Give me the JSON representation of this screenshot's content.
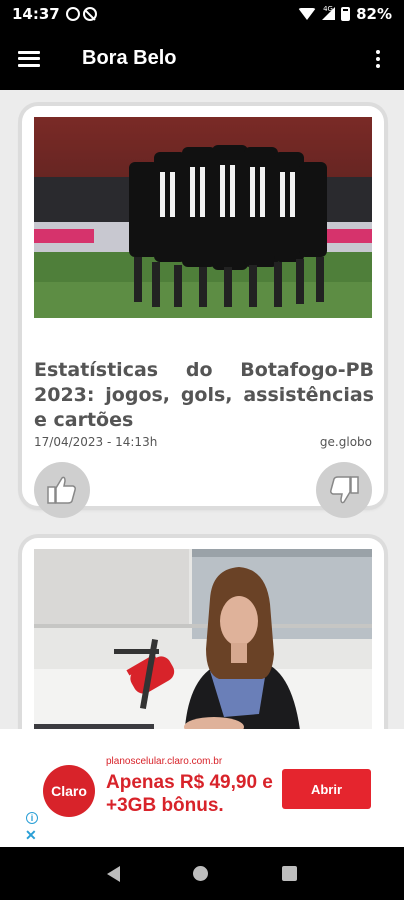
{
  "status_bar": {
    "time": "14:37",
    "battery": "82%",
    "network_tag": "4G",
    "icons": [
      "whatsapp-icon",
      "blocked-icon",
      "wifi-icon",
      "signal-icon",
      "battery-icon"
    ]
  },
  "app_bar": {
    "title": "Bora Belo",
    "icons": [
      "hamburger-menu-icon",
      "more-vert-icon"
    ]
  },
  "feed": {
    "articles": [
      {
        "title": "Estatísticas do Botafogo-PB 2023: jogos, gols, assistências e cartões",
        "date": "17/04/2023 - 14:13h",
        "source": "ge.globo",
        "image": "team-huddle-photo",
        "actions": [
          "thumbs-up-icon",
          "thumbs-down-icon"
        ]
      },
      {
        "title": "",
        "image": "woman-radio-studio-photo"
      }
    ]
  },
  "ad": {
    "logo_text": "Claro",
    "url": "planoscelular.claro.com.br",
    "headline": "Apenas R$ 49,90 e +3GB bônus.",
    "cta": "Abrir",
    "info_icon": "i",
    "close_icon": "✕",
    "brand_color": "#d8232a"
  },
  "nav_bar": {
    "icons": [
      "back-icon",
      "home-icon",
      "recents-icon"
    ]
  }
}
